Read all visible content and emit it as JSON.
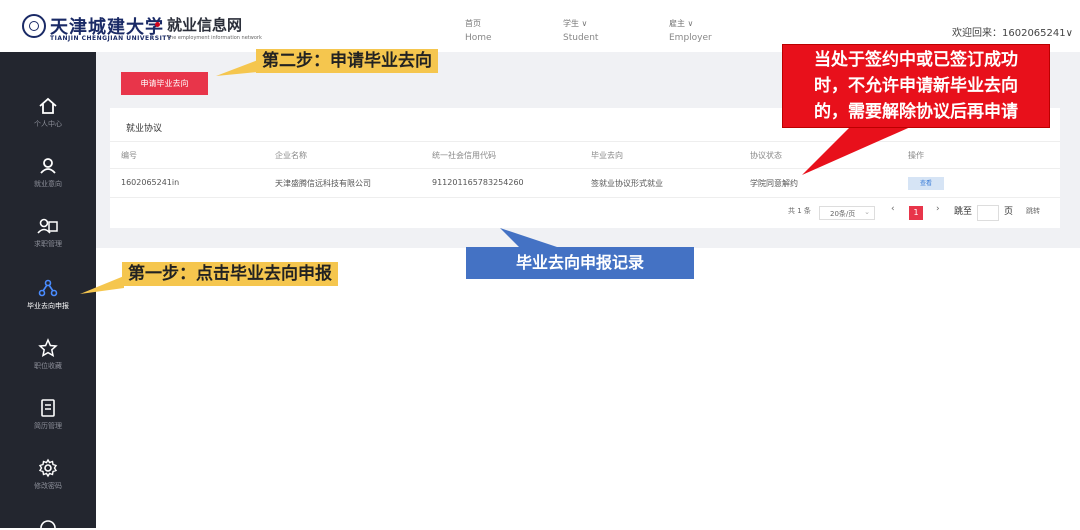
{
  "header": {
    "university_cn": "天津城建大学",
    "university_en": "TIANJIN CHENGJIAN UNIVERSITY",
    "site_title": "就业信息网",
    "site_subtitle": "The employment information network",
    "nav": [
      {
        "cn": "首页",
        "en": "Home"
      },
      {
        "cn": "学生 ∨",
        "en": "Student"
      },
      {
        "cn": "雇主 ∨",
        "en": "Employer"
      }
    ],
    "welcome": "欢迎回来：1602065241∨"
  },
  "sidebar": {
    "items": [
      {
        "label": "个人中心",
        "icon": "home-icon"
      },
      {
        "label": "就业意向",
        "icon": "users-icon"
      },
      {
        "label": "求职管理",
        "icon": "user-card-icon"
      },
      {
        "label": "毕业去向申报",
        "icon": "network-icon"
      },
      {
        "label": "职位收藏",
        "icon": "star-icon"
      },
      {
        "label": "简历管理",
        "icon": "document-icon"
      },
      {
        "label": "修改密码",
        "icon": "gear-icon"
      }
    ]
  },
  "main": {
    "apply_button": "申请毕业去向",
    "card_title": "就业协议",
    "table": {
      "headers": [
        "编号",
        "企业名称",
        "统一社会信用代码",
        "毕业去向",
        "协议状态",
        "操作"
      ],
      "rows": [
        [
          "1602065241in",
          "天津盛腾信远科技有限公司",
          "911201165783254260",
          "签就业协议形式就业",
          "学院同意解约",
          "查看"
        ]
      ]
    },
    "pagination": {
      "total": "共 1 条",
      "per_page": "20条/页",
      "prev": "‹",
      "current": "1",
      "next": "›",
      "goto": "跳至",
      "page_unit": "页",
      "jump": "跳转"
    }
  },
  "annotations": {
    "step2": "第二步：申请毕业去向",
    "step1": "第一步：点击毕业去向申报",
    "records": "毕业去向申报记录",
    "warning_lines": [
      "当处于签约中或已签订成功",
      "时，不允许申请新毕业去向",
      "的，需要解除协议后再申请"
    ]
  },
  "colors": {
    "accent_red": "#e8354a",
    "sidebar_bg": "#23262f",
    "annotation_yellow": "#f5c64e",
    "annotation_blue": "#4472c4",
    "annotation_red": "#e8101b"
  }
}
